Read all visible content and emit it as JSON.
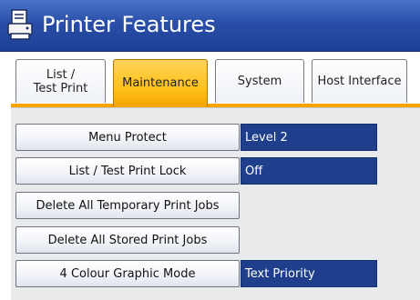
{
  "window": {
    "title": "Printer Features",
    "icon": "printer-icon"
  },
  "tabs": [
    {
      "label": "List / Test Print",
      "active": false
    },
    {
      "label": "Maintenance",
      "active": true
    },
    {
      "label": "System",
      "active": false
    },
    {
      "label": "Host Interface",
      "active": false
    }
  ],
  "items": [
    {
      "label": "Menu Protect",
      "value": "Level 2"
    },
    {
      "label": "List / Test Print Lock",
      "value": "Off"
    },
    {
      "label": "Delete All Temporary Print Jobs",
      "value": null
    },
    {
      "label": "Delete All Stored Print Jobs",
      "value": null
    },
    {
      "label": "4 Colour Graphic Mode",
      "value": "Text Priority"
    }
  ],
  "colors": {
    "titlebar": "#2a4ea8",
    "active_tab": "#ffc21a",
    "value_field": "#1f3f8d",
    "content_bg": "#e9eaec"
  }
}
